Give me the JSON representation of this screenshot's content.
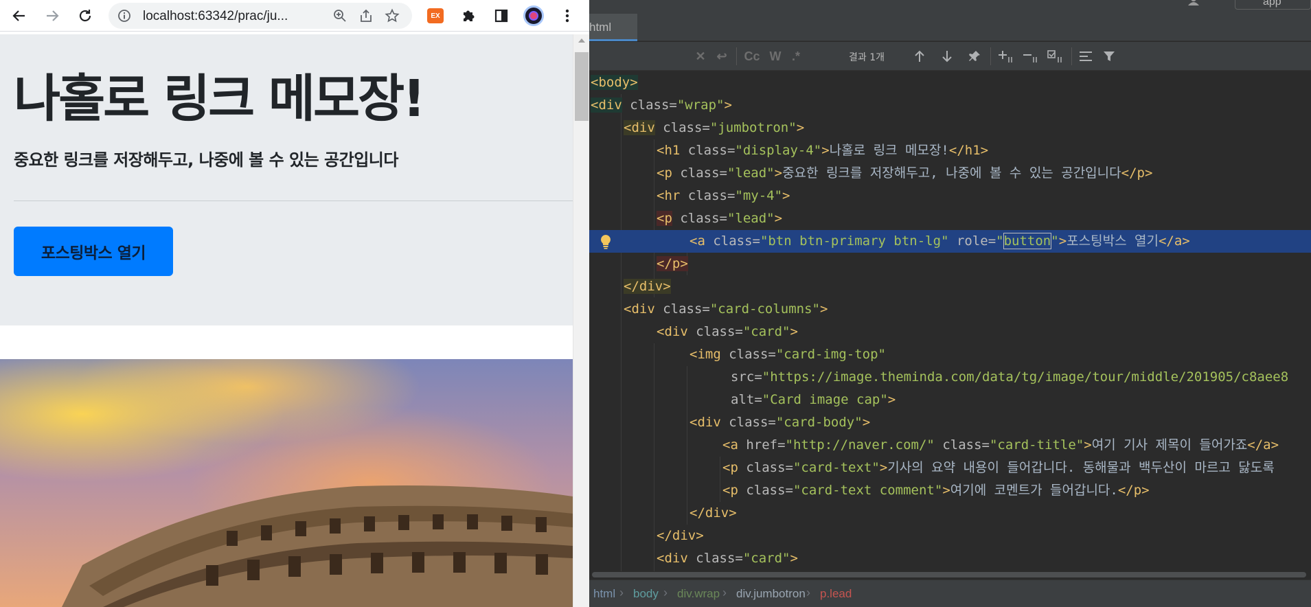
{
  "browser": {
    "url": "localhost:63342/prac/ju...",
    "extension_badge": "EX",
    "page": {
      "title": "나홀로 링크 메모장!",
      "lead": "중요한 링크를 저장해두고, 나중에 볼 수 있는 공간입니다",
      "button_label": "포스팅박스 열기"
    }
  },
  "ide": {
    "run_config": "app",
    "tab_label": "html",
    "search": {
      "result_count": "결과 1개",
      "toggles": {
        "case": "Cc",
        "word": "W",
        "regex": ".*"
      }
    },
    "code_lines": [
      [
        {
          "t": "<body>",
          "c": "tg hl-body"
        }
      ],
      [
        {
          "t": "<div",
          "c": "tg hl-body"
        },
        {
          "t": " class=",
          "c": "at"
        },
        {
          "t": "\"wrap\"",
          "c": "vl"
        },
        {
          "t": ">",
          "c": "tg"
        }
      ],
      [
        {
          "t": "<div",
          "c": "tg hl-tag"
        },
        {
          "t": " class=",
          "c": "at"
        },
        {
          "t": "\"jumbotron\"",
          "c": "vl"
        },
        {
          "t": ">",
          "c": "tg"
        }
      ],
      [
        {
          "t": "<h1",
          "c": "tg"
        },
        {
          "t": " class=",
          "c": "at"
        },
        {
          "t": "\"display-4\"",
          "c": "vl"
        },
        {
          "t": ">",
          "c": "tg"
        },
        {
          "t": "나홀로 링크 메모장!",
          "c": "tx"
        },
        {
          "t": "</h1>",
          "c": "tg"
        }
      ],
      [
        {
          "t": "<p",
          "c": "tg"
        },
        {
          "t": " class=",
          "c": "at"
        },
        {
          "t": "\"lead\"",
          "c": "vl"
        },
        {
          "t": ">",
          "c": "tg"
        },
        {
          "t": "중요한 링크를 저장해두고, 나중에 볼 수 있는 공간입니다",
          "c": "tx"
        },
        {
          "t": "</p>",
          "c": "tg"
        }
      ],
      [
        {
          "t": "<hr",
          "c": "tg"
        },
        {
          "t": " class=",
          "c": "at"
        },
        {
          "t": "\"my-4\"",
          "c": "vl"
        },
        {
          "t": ">",
          "c": "tg"
        }
      ],
      [
        {
          "t": "<p",
          "c": "tg hl-tag-red"
        },
        {
          "t": " class=",
          "c": "at"
        },
        {
          "t": "\"lead\"",
          "c": "vl"
        },
        {
          "t": ">",
          "c": "tg"
        }
      ],
      [
        {
          "t": "<a",
          "c": "tg"
        },
        {
          "t": " class=",
          "c": "at"
        },
        {
          "t": "\"btn btn-primary btn-lg\"",
          "c": "vl"
        },
        {
          "t": " role=",
          "c": "at"
        },
        {
          "t": "\"",
          "c": "vl"
        },
        {
          "t": "button",
          "c": "vl word-box"
        },
        {
          "t": "\"",
          "c": "vl"
        },
        {
          "t": ">",
          "c": "tg"
        },
        {
          "t": "포스팅박스 열기",
          "c": "tx"
        },
        {
          "t": "</a>",
          "c": "tg"
        }
      ],
      [
        {
          "t": "</p>",
          "c": "tg hl-tag-red"
        }
      ],
      [
        {
          "t": "</div>",
          "c": "tg hl-tag"
        }
      ],
      [
        {
          "t": "<div",
          "c": "tg"
        },
        {
          "t": " class=",
          "c": "at"
        },
        {
          "t": "\"card-columns\"",
          "c": "vl"
        },
        {
          "t": ">",
          "c": "tg"
        }
      ],
      [
        {
          "t": "<div",
          "c": "tg"
        },
        {
          "t": " class=",
          "c": "at"
        },
        {
          "t": "\"card\"",
          "c": "vl"
        },
        {
          "t": ">",
          "c": "tg"
        }
      ],
      [
        {
          "t": "<img",
          "c": "tg"
        },
        {
          "t": " class=",
          "c": "at"
        },
        {
          "t": "\"card-img-top\"",
          "c": "vl"
        }
      ],
      [
        {
          "t": "src=",
          "c": "at"
        },
        {
          "t": "\"https://image.theminda.com/data/tg/image/tour/middle/201905/c8aee8",
          "c": "vl"
        }
      ],
      [
        {
          "t": "alt=",
          "c": "at"
        },
        {
          "t": "\"Card image cap\"",
          "c": "vl"
        },
        {
          "t": ">",
          "c": "tg"
        }
      ],
      [
        {
          "t": "<div",
          "c": "tg"
        },
        {
          "t": " class=",
          "c": "at"
        },
        {
          "t": "\"card-body\"",
          "c": "vl"
        },
        {
          "t": ">",
          "c": "tg"
        }
      ],
      [
        {
          "t": "<a",
          "c": "tg"
        },
        {
          "t": " href=",
          "c": "at"
        },
        {
          "t": "\"http://naver.com/\"",
          "c": "vl"
        },
        {
          "t": " class=",
          "c": "at"
        },
        {
          "t": "\"card-title\"",
          "c": "vl"
        },
        {
          "t": ">",
          "c": "tg"
        },
        {
          "t": "여기 기사 제목이 들어가죠",
          "c": "tx"
        },
        {
          "t": "</a>",
          "c": "tg"
        }
      ],
      [
        {
          "t": "<p",
          "c": "tg"
        },
        {
          "t": " class=",
          "c": "at"
        },
        {
          "t": "\"card-text\"",
          "c": "vl"
        },
        {
          "t": ">",
          "c": "tg"
        },
        {
          "t": "기사의 요약 내용이 들어갑니다. 동해물과 백두산이 마르고 닳도록",
          "c": "tx"
        }
      ],
      [
        {
          "t": "<p",
          "c": "tg"
        },
        {
          "t": " class=",
          "c": "at"
        },
        {
          "t": "\"card-text comment\"",
          "c": "vl"
        },
        {
          "t": ">",
          "c": "tg"
        },
        {
          "t": "여기에 코멘트가 들어갑니다.",
          "c": "tx"
        },
        {
          "t": "</p>",
          "c": "tg"
        }
      ],
      [
        {
          "t": "</div>",
          "c": "tg"
        }
      ],
      [
        {
          "t": "</div>",
          "c": "tg"
        }
      ],
      [
        {
          "t": "<div",
          "c": "tg"
        },
        {
          "t": " class=",
          "c": "at"
        },
        {
          "t": "\"card\"",
          "c": "vl"
        },
        {
          "t": ">",
          "c": "tg"
        }
      ]
    ],
    "breadcrumbs": [
      {
        "label": "html",
        "color": "#7b93ad"
      },
      {
        "label": "body",
        "color": "#5f9ea0"
      },
      {
        "label": "div.wrap",
        "color": "#6a8759"
      },
      {
        "label": "div.jumbotron",
        "color": "#9aa6b2"
      },
      {
        "label": "p.lead",
        "color": "#c75450"
      }
    ]
  },
  "colors": {
    "primary_button": "#007bff",
    "jumbotron_bg": "#e9ecef",
    "ide_bg": "#2b2b2b",
    "selection": "#214283"
  }
}
